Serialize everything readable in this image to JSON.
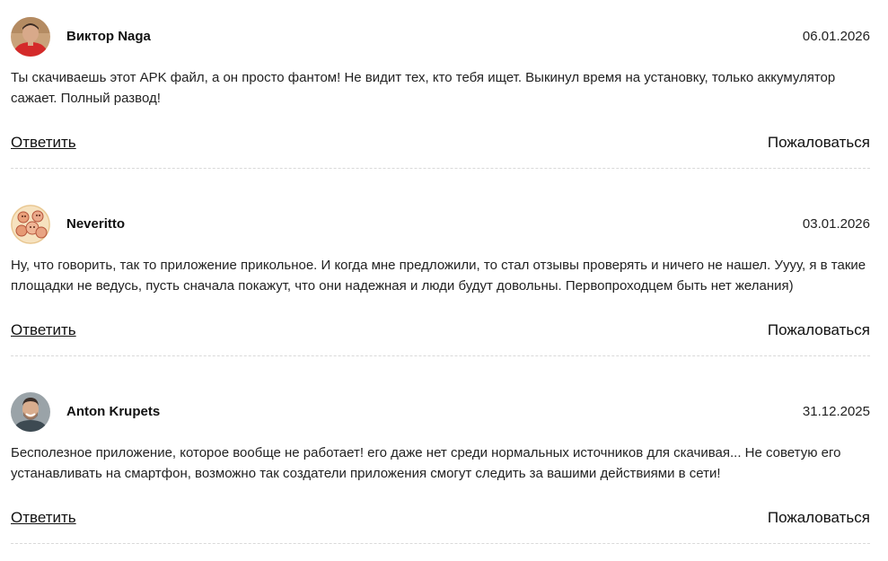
{
  "comments": [
    {
      "author": "Виктор Naga",
      "date": "06.01.2026",
      "text": "Ты скачиваешь этот APK файл, а он просто фантом! Не видит тех, кто тебя ищет. Выкинул время на установку, только аккумулятор сажает. Полный развод!",
      "reply_label": "Ответить",
      "report_label": "Пожаловаться",
      "avatar_icon": "user-photo-red-shirt"
    },
    {
      "author": "Neveritto",
      "date": "03.01.2026",
      "text": "Ну, что говорить, так то приложение прикольное. И когда мне предложили, то стал отзывы проверять и ничего не нашел. Уууу, я в такие площадки не ведусь, пусть сначала покажут, что они надежная и люди будут довольны. Первопроходцем быть нет желания)",
      "reply_label": "Ответить",
      "report_label": "Пожаловаться",
      "avatar_icon": "cartoon-faces-avatar"
    },
    {
      "author": "Anton Krupets",
      "date": "31.12.2025",
      "text": "Бесполезное приложение, которое вообще не работает! его даже нет среди нормальных источников для скачивая... Не советую его устанавливать на смартфон, возможно так создатели приложения смогут следить за вашими действиями в сети!",
      "reply_label": "Ответить",
      "report_label": "Пожаловаться",
      "avatar_icon": "user-photo-smiling-man"
    }
  ]
}
